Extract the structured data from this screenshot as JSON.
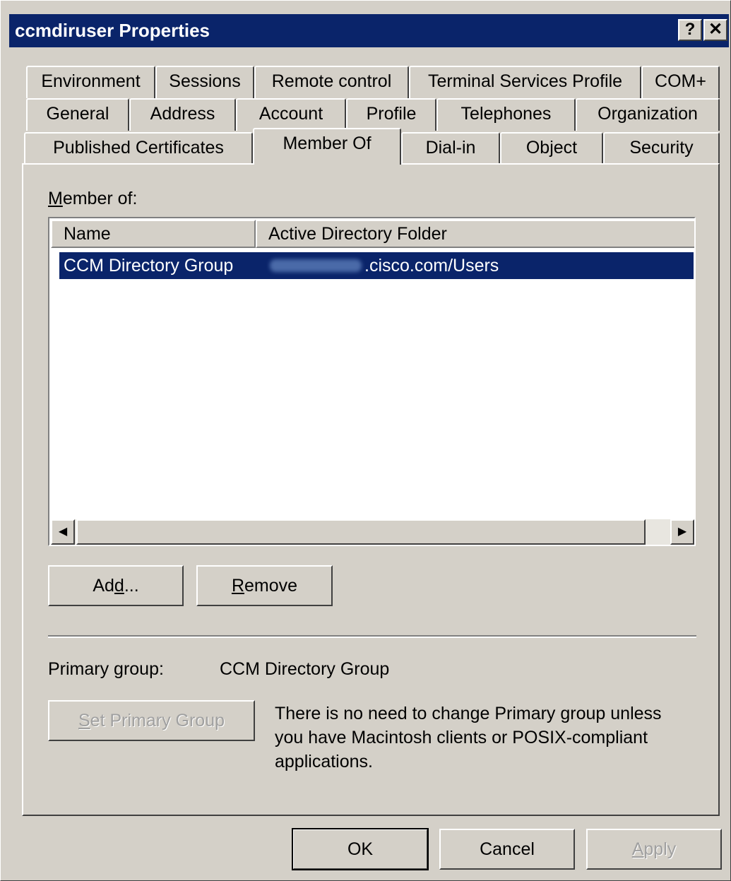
{
  "window": {
    "title": "ccmdiruser Properties",
    "help_label": "?",
    "close_label": "✕"
  },
  "tabs": {
    "row1": [
      "Environment",
      "Sessions",
      "Remote control",
      "Terminal Services Profile",
      "COM+"
    ],
    "row2": [
      "General",
      "Address",
      "Account",
      "Profile",
      "Telephones",
      "Organization"
    ],
    "row3": [
      "Published Certificates",
      "Member Of",
      "Dial-in",
      "Object",
      "Security"
    ],
    "active": "Member Of"
  },
  "member_of": {
    "label": "Member of:",
    "columns": [
      "Name",
      "Active Directory Folder"
    ],
    "rows": [
      {
        "name": "CCM Directory Group",
        "folder_suffix": ".cisco.com/Users",
        "selected": true
      }
    ]
  },
  "buttons": {
    "add": "Add...",
    "remove": "Remove",
    "set_primary": "Set Primary Group",
    "ok": "OK",
    "cancel": "Cancel",
    "apply": "Apply"
  },
  "primary_group": {
    "label": "Primary group:",
    "value": "CCM Directory Group",
    "note_lines": [
      "There is no need to change Primary group unless",
      "you have Macintosh clients or POSIX-compliant",
      "applications."
    ]
  },
  "colors": {
    "titlebar": "#0a246a",
    "face": "#d4d0c8",
    "selection": "#0a246a"
  }
}
